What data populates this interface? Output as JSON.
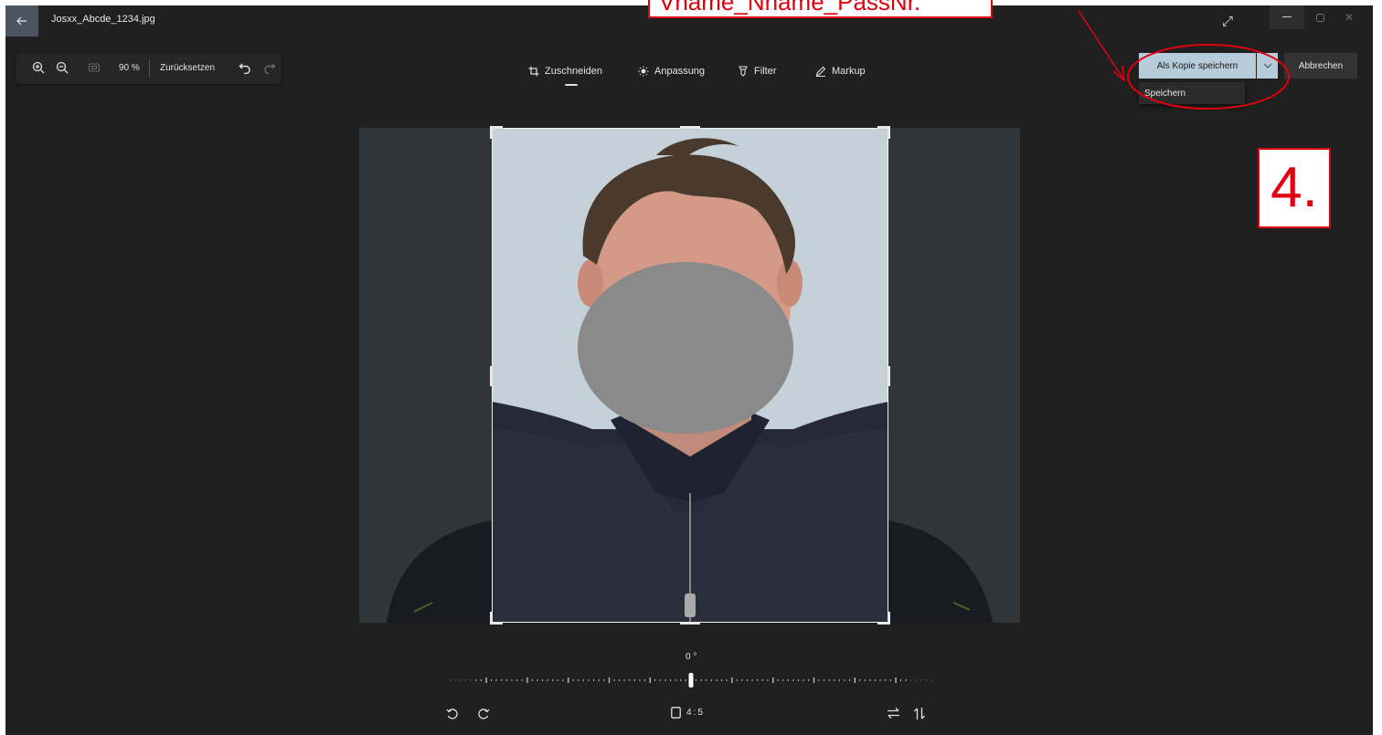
{
  "window": {
    "file_name": "Josxx_Abcde_1234.jpg"
  },
  "zoom_toolbar": {
    "zoom_level": "90 %",
    "reset_label": "Zurücksetzen"
  },
  "edit_tabs": [
    {
      "label": "Zuschneiden",
      "icon": "crop-icon",
      "active": true
    },
    {
      "label": "Anpassung",
      "icon": "brightness-icon",
      "active": false
    },
    {
      "label": "Filter",
      "icon": "filter-icon",
      "active": false
    },
    {
      "label": "Markup",
      "icon": "pen-icon",
      "active": false
    }
  ],
  "save": {
    "save_copy_label": "Als Kopie speichern",
    "cancel_label": "Abbrechen",
    "menu_item": "Speichern"
  },
  "rotation": {
    "value_label": "0 °"
  },
  "aspect_ratio": {
    "label": "4:5"
  },
  "annotations": {
    "callout_text": "Vname_Nname_PassNr.",
    "step_label": "4.",
    "color": "#e0000f"
  },
  "colors": {
    "accent": "#b6ccd8",
    "background": "#202020"
  }
}
